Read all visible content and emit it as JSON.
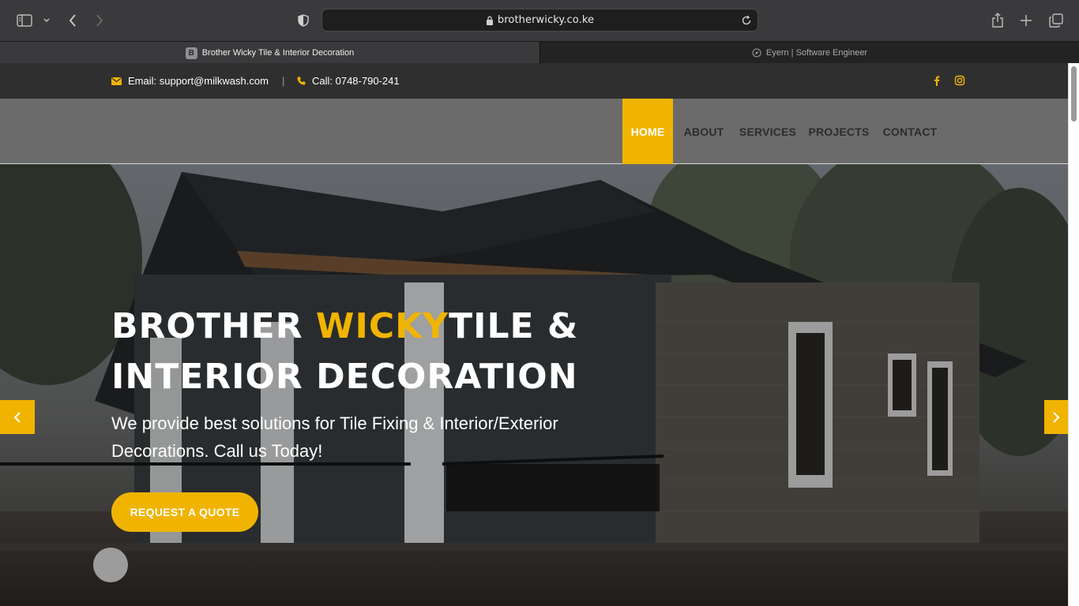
{
  "browser": {
    "url": "brotherwicky.co.ke",
    "tabs": [
      {
        "label": "Brother Wicky Tile & Interior Decoration",
        "favicon": "B",
        "active": true
      },
      {
        "label": "Eyern | Software Engineer",
        "active": false
      }
    ]
  },
  "topbar": {
    "email": "Email: support@milkwash.com",
    "separator": "|",
    "call": "Call: 0748-790-241",
    "social": [
      "facebook-icon",
      "instagram-icon"
    ]
  },
  "nav": {
    "items": [
      "HOME",
      "ABOUT",
      "SERVICES",
      "PROJECTS",
      "CONTACT"
    ],
    "active": "HOME"
  },
  "hero": {
    "title_part1": "BROTHER ",
    "title_accent": "WICKY",
    "title_part2": "TILE &",
    "title_line2": "INTERIOR DECORATION",
    "subtitle": "We provide best solutions for Tile Fixing & Interior/Exterior Decorations. Call us Today!",
    "cta": "REQUEST A QUOTE"
  },
  "colors": {
    "accent": "#f0b400",
    "topbar_bg": "#2f2f2f",
    "navbar_bg": "#6b6b6b"
  }
}
